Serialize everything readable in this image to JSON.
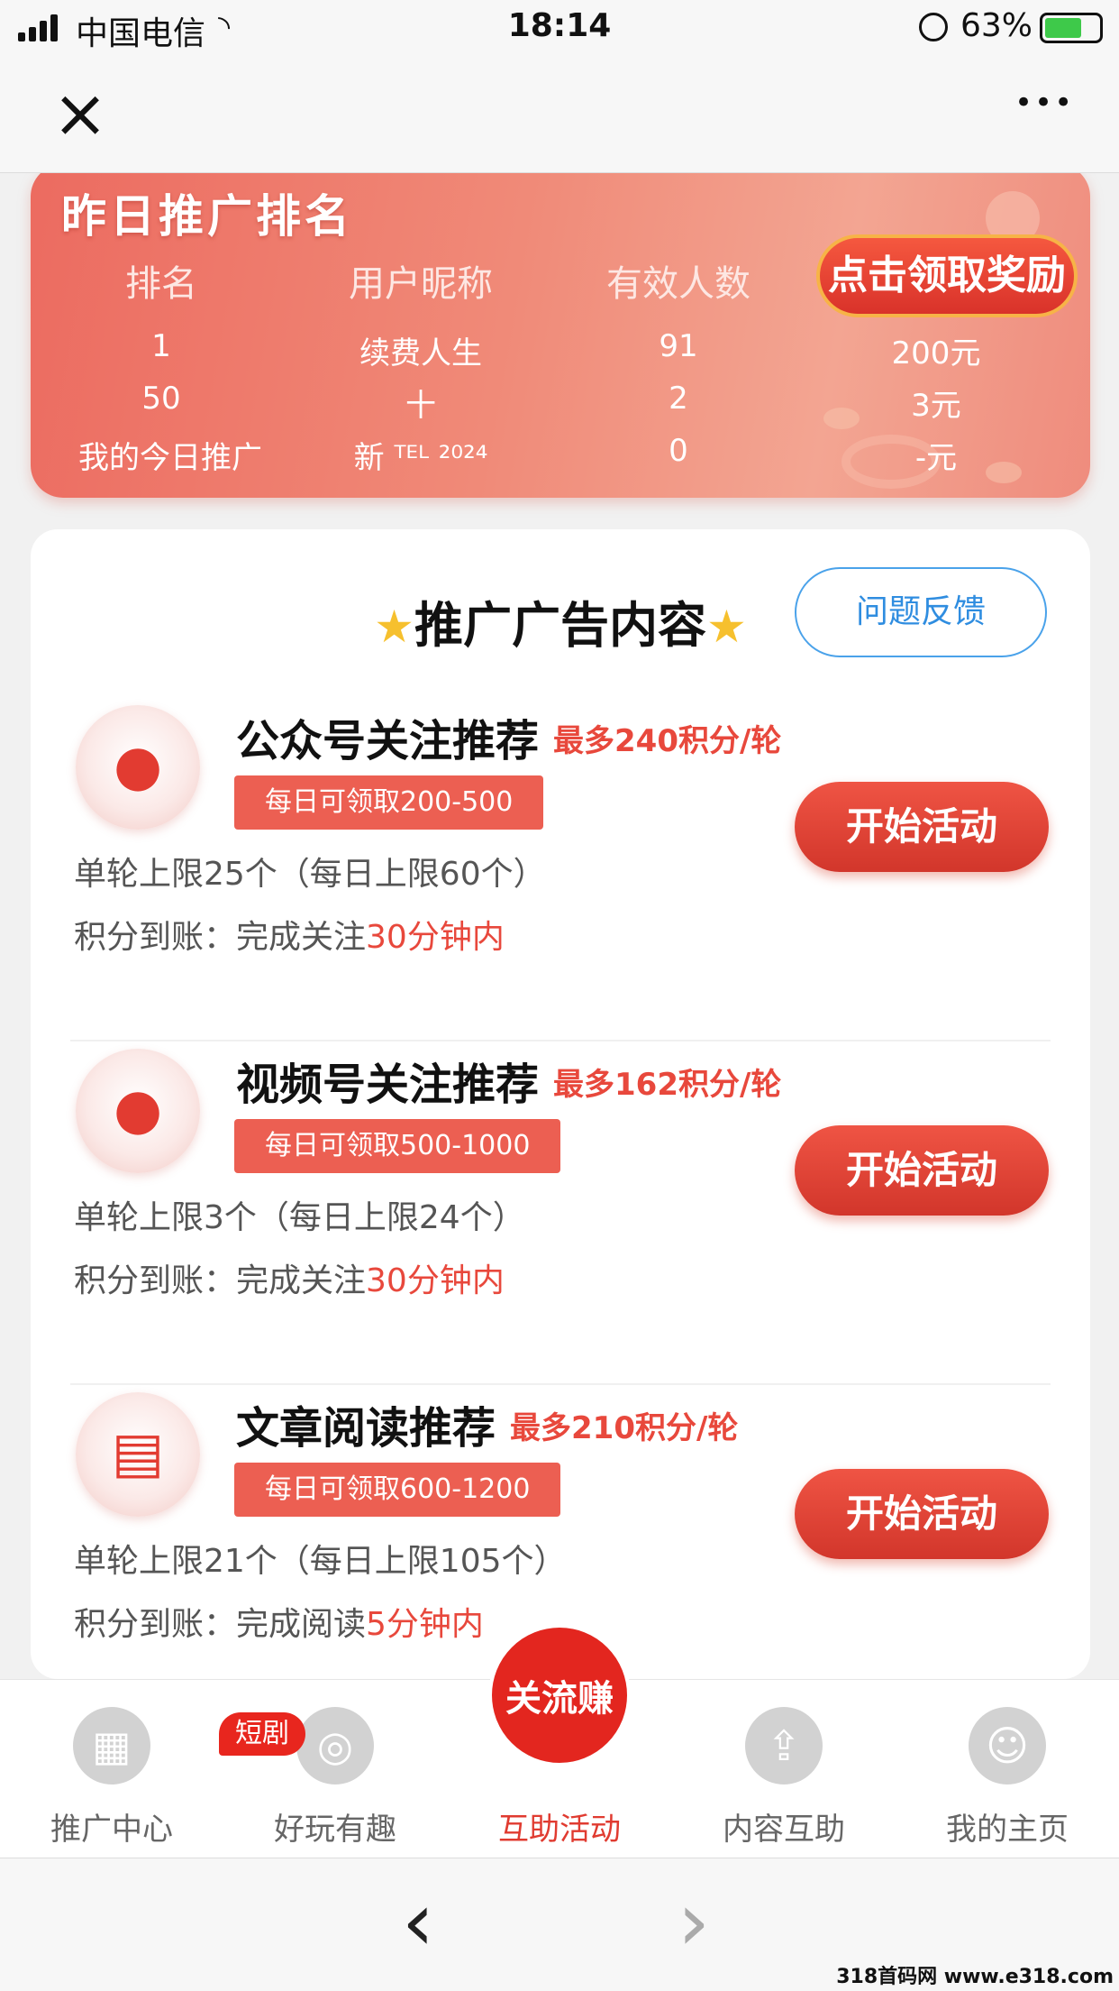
{
  "status": {
    "carrier": "中国电信",
    "time": "18:14",
    "battery": "63%"
  },
  "nav": {
    "close": "×",
    "more": "•••"
  },
  "rank": {
    "title": "昨日推广排名",
    "headers": [
      "排名",
      "用户昵称",
      "有效人数"
    ],
    "claim": "点击领取奖励",
    "rows": [
      {
        "rank": "1",
        "name": "续费人生",
        "count": "91",
        "reward": "200元"
      },
      {
        "rank": "50",
        "name": "十",
        "count": "2",
        "reward": "3元"
      },
      {
        "rank": "我的今日推广",
        "name": "新 ᵀᴱᴸ ²⁰²⁴",
        "count": "0",
        "reward": "-元"
      }
    ]
  },
  "card": {
    "title": "推广广告内容",
    "feedback": "问题反馈"
  },
  "tasks": [
    {
      "name": "公众号关注推荐",
      "max": "最多240积分/轮",
      "badge": "每日可领取200-500",
      "limit": "单轮上限25个（每日上限60个）",
      "arr_prefix": "积分到账：完成关注",
      "arr_hl": "30分钟内",
      "btn": "开始活动"
    },
    {
      "name": "视频号关注推荐",
      "max": "最多162积分/轮",
      "badge": "每日可领取500-1000",
      "limit": "单轮上限3个（每日上限24个）",
      "arr_prefix": "积分到账：完成关注",
      "arr_hl": "30分钟内",
      "btn": "开始活动"
    },
    {
      "name": "文章阅读推荐",
      "max": "最多210积分/轮",
      "badge": "每日可领取600-1200",
      "limit": "单轮上限21个（每日上限105个）",
      "arr_prefix": "积分到账：完成阅读",
      "arr_hl": "5分钟内",
      "btn": "开始活动"
    }
  ],
  "tabs": [
    "推广中心",
    "好玩有趣",
    "互助活动",
    "内容互助",
    "我的主页"
  ],
  "tab_badge": "短剧",
  "center_logo": "关流赚",
  "browser": {
    "back": "‹",
    "forward": "›"
  },
  "watermark": "318首码网 www.e318.com"
}
